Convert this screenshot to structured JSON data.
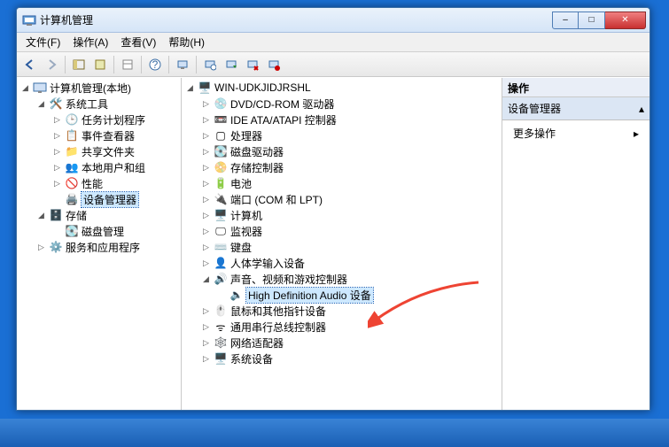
{
  "window": {
    "title": "计算机管理",
    "buttons": {
      "min": "–",
      "max": "□",
      "close": "✕"
    }
  },
  "menu": {
    "file": "文件(F)",
    "action": "操作(A)",
    "view": "查看(V)",
    "help": "帮助(H)"
  },
  "left_tree": {
    "root": "计算机管理(本地)",
    "sys_tools": "系统工具",
    "task_sched": "任务计划程序",
    "event_viewer": "事件查看器",
    "shared": "共享文件夹",
    "users": "本地用户和组",
    "perf": "性能",
    "devmgr": "设备管理器",
    "storage": "存储",
    "diskmgr": "磁盘管理",
    "services": "服务和应用程序"
  },
  "mid_tree": {
    "root": "WIN-UDKJIDJRSHL",
    "dvd": "DVD/CD-ROM 驱动器",
    "ide": "IDE ATA/ATAPI 控制器",
    "cpu": "处理器",
    "disk": "磁盘驱动器",
    "storage_ctrl": "存储控制器",
    "battery": "电池",
    "ports": "端口 (COM 和 LPT)",
    "computer": "计算机",
    "monitor": "监视器",
    "keyboard": "键盘",
    "hid": "人体学输入设备",
    "sound": "声音、视频和游戏控制器",
    "sound_dev": "High Definition Audio 设备",
    "mouse": "鼠标和其他指针设备",
    "usb": "通用串行总线控制器",
    "net": "网络适配器",
    "sysdev": "系统设备"
  },
  "right": {
    "header": "操作",
    "section": "设备管理器",
    "more": "更多操作"
  },
  "icons": {
    "tri_open": "◢",
    "tri_closed": "▷",
    "chev_right": "▸"
  }
}
